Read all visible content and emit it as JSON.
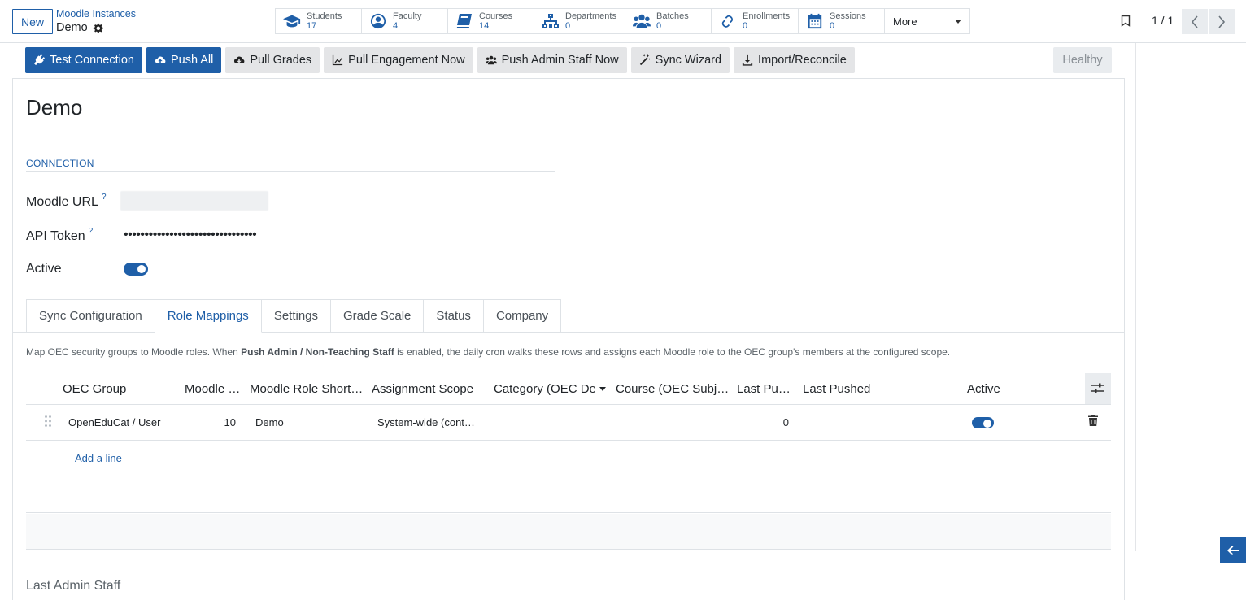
{
  "control_panel": {
    "new_label": "New",
    "breadcrumb_parent": "Moodle Instances",
    "breadcrumb_current": "Demo",
    "smart_buttons": [
      {
        "label": "Students",
        "value": "17",
        "icon": "graduation-cap-icon"
      },
      {
        "label": "Faculty",
        "value": "4",
        "icon": "user-circle-icon"
      },
      {
        "label": "Courses",
        "value": "14",
        "icon": "book-icon"
      },
      {
        "label": "Departments",
        "value": "0",
        "icon": "sitemap-icon"
      },
      {
        "label": "Batches",
        "value": "0",
        "icon": "users-icon"
      },
      {
        "label": "Enrollments",
        "value": "0",
        "icon": "link-icon"
      },
      {
        "label": "Sessions",
        "value": "0",
        "icon": "calendar-icon"
      }
    ],
    "more_label": "More",
    "pager": "1 / 1"
  },
  "actions": {
    "test_connection": "Test Connection",
    "push_all": "Push All",
    "pull_grades": "Pull Grades",
    "pull_engagement": "Pull Engagement Now",
    "push_admin_staff": "Push Admin Staff Now",
    "sync_wizard": "Sync Wizard",
    "import_reconcile": "Import/Reconcile",
    "status": "Healthy"
  },
  "record": {
    "title": "Demo",
    "section_connection": "CONNECTION",
    "moodle_url_label": "Moodle URL",
    "api_token_label": "API Token",
    "api_token_value": "••••••••••••••••••••••••••••••••",
    "active_label": "Active",
    "help_mark": "?"
  },
  "tabs": [
    "Sync Configuration",
    "Role Mappings",
    "Settings",
    "Grade Scale",
    "Status",
    "Company"
  ],
  "role_mappings": {
    "help_prefix": "Map OEC security groups to Moodle roles. When ",
    "help_bold": "Push Admin / Non-Teaching Staff",
    "help_suffix": " is enabled, the daily cron walks these rows and assigns each Moodle role to the OEC group's members at the configured scope.",
    "columns": [
      "OEC Group",
      "Moodle …",
      "Moodle Role Short…",
      "Assignment Scope",
      "Category (OEC De",
      "Course (OEC Subje…",
      "Last Pus…",
      "Last Pushed",
      "Active"
    ],
    "rows": [
      {
        "oec_group": "OpenEduCat / User",
        "moodle_role_id": "10",
        "role_short": "Demo",
        "scope": "System-wide (cont…",
        "category": "",
        "course": "",
        "last_pus": "0",
        "last_pushed": "",
        "active": true
      }
    ],
    "add_line": "Add a line"
  },
  "last_admin_staff_label": "Last Admin Staff",
  "colors": {
    "primary": "#1f5fa8",
    "secondary_btn": "#e4e5e7",
    "border": "#dee2e6"
  }
}
